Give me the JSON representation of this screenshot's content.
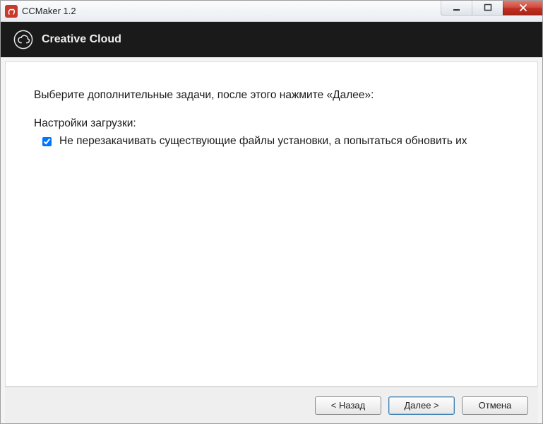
{
  "window": {
    "title": "CCMaker 1.2"
  },
  "banner": {
    "title": "Creative Cloud"
  },
  "main": {
    "instruction": "Выберите дополнительные задачи, после этого нажмите «Далее»:",
    "section_label": "Настройки загрузки:",
    "options": [
      {
        "label": "Не перезакачивать существующие файлы установки, а попытаться обновить их",
        "checked": true
      }
    ]
  },
  "footer": {
    "back": "< Назад",
    "next": "Далее >",
    "cancel": "Отмена"
  }
}
